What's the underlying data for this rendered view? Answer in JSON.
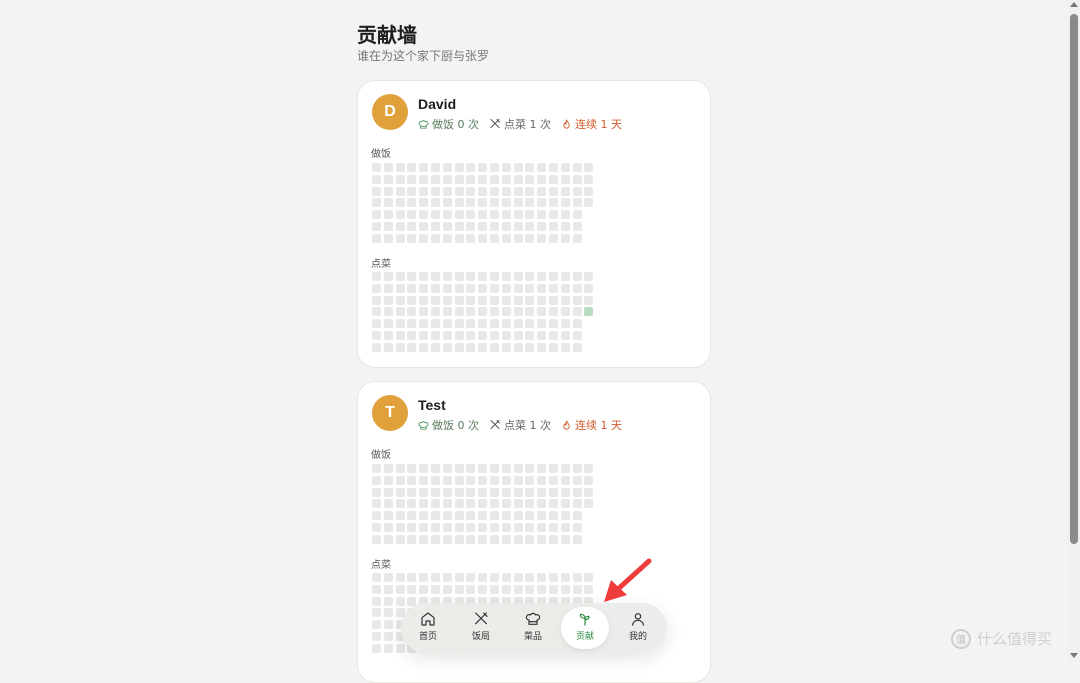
{
  "page": {
    "title": "贡献墙",
    "subtitle": "谁在为这个家下厨与张罗"
  },
  "members": [
    {
      "initial": "D",
      "name": "David",
      "cook_stat": "做饭 0 次",
      "order_stat": "点菜 1 次",
      "streak_stat": "连续 1 天",
      "cook_label": "做饭",
      "order_label": "点菜",
      "cook_active_cells": [],
      "order_active_cells": [
        [
          18,
          3
        ]
      ]
    },
    {
      "initial": "T",
      "name": "Test",
      "cook_stat": "做饭 0 次",
      "order_stat": "点菜 1 次",
      "streak_stat": "连续 1 天",
      "cook_label": "做饭",
      "order_label": "点菜",
      "cook_active_cells": [],
      "order_active_cells": []
    }
  ],
  "nav": {
    "items": [
      {
        "label": "首页",
        "icon": "home-icon"
      },
      {
        "label": "饭局",
        "icon": "utensils-icon"
      },
      {
        "label": "菜品",
        "icon": "chef-hat-icon"
      },
      {
        "label": "贡献",
        "icon": "sprout-icon"
      },
      {
        "label": "我的",
        "icon": "user-icon"
      }
    ],
    "active_index": 3
  },
  "watermark": {
    "badge": "值",
    "text": "什么值得买"
  },
  "colors": {
    "accent": "#2f8c44",
    "avatar": "#e0a13a",
    "streak": "#d05a2a",
    "cell_empty": "#e8e8e6",
    "cell_active": "#b7dcbf",
    "annotation_arrow": "#ee3b3b"
  }
}
